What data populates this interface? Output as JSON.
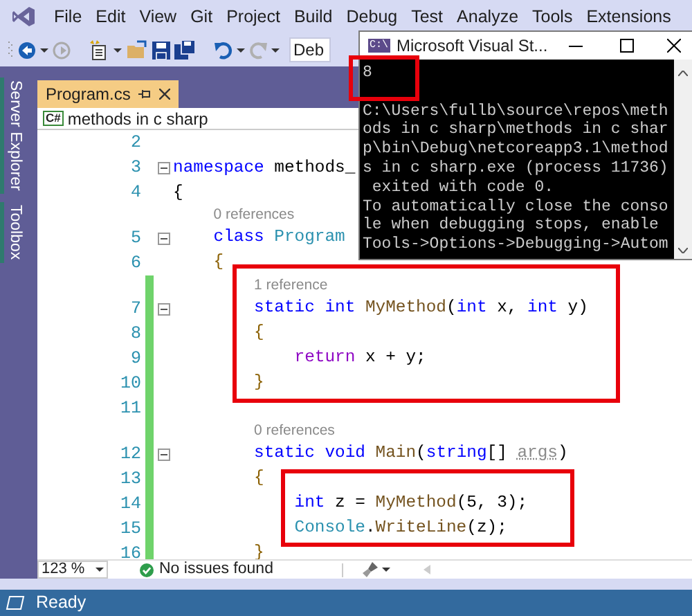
{
  "menu": {
    "items": [
      "File",
      "Edit",
      "View",
      "Git",
      "Project",
      "Build",
      "Debug",
      "Test",
      "Analyze",
      "Tools",
      "Extensions"
    ]
  },
  "toolbar": {
    "configuration": "Deb"
  },
  "side_tabs": [
    "Server Explorer",
    "Toolbox"
  ],
  "document_tabs": [
    {
      "title": "Program.cs",
      "selected": true
    }
  ],
  "navigation_bar": {
    "file_icon": "C#",
    "project": "methods in c sharp"
  },
  "editor": {
    "lines": [
      {
        "kind": "code",
        "number": "2",
        "changed": false,
        "foldable": false
      },
      {
        "kind": "code",
        "number": "3",
        "changed": false,
        "foldable": true,
        "tokens": [
          {
            "kind": "keyword",
            "text": "namespace "
          },
          {
            "kind": "plain",
            "text": "methods_"
          }
        ]
      },
      {
        "kind": "code",
        "number": "4",
        "changed": false,
        "foldable": false,
        "tokens": [
          {
            "kind": "plain",
            "text": "{"
          }
        ]
      },
      {
        "kind": "codelens",
        "text": "0 references",
        "changed": false
      },
      {
        "kind": "code",
        "number": "5",
        "changed": false,
        "foldable": true,
        "tokens": [
          {
            "kind": "keyword",
            "text": "    class "
          },
          {
            "kind": "type",
            "text": "Program"
          }
        ]
      },
      {
        "kind": "code",
        "number": "6",
        "changed": false,
        "foldable": false,
        "tokens": [
          {
            "kind": "brace",
            "text": "    {"
          }
        ]
      },
      {
        "kind": "codelens",
        "text": "1 reference",
        "changed": true
      },
      {
        "kind": "code",
        "number": "7",
        "changed": true,
        "foldable": true,
        "tokens": [
          {
            "kind": "keyword",
            "text": "        static int "
          },
          {
            "kind": "method",
            "text": "MyMethod"
          },
          {
            "kind": "plain",
            "text": "("
          },
          {
            "kind": "keyword",
            "text": "int "
          },
          {
            "kind": "plain",
            "text": "x, "
          },
          {
            "kind": "keyword",
            "text": "int "
          },
          {
            "kind": "plain",
            "text": "y)"
          }
        ]
      },
      {
        "kind": "code",
        "number": "8",
        "changed": true,
        "foldable": false,
        "tokens": [
          {
            "kind": "brace",
            "text": "        {"
          }
        ]
      },
      {
        "kind": "code",
        "number": "9",
        "changed": true,
        "foldable": false,
        "tokens": [
          {
            "kind": "control",
            "text": "            return "
          },
          {
            "kind": "plain",
            "text": "x + y;"
          }
        ]
      },
      {
        "kind": "code",
        "number": "10",
        "changed": true,
        "foldable": false,
        "tokens": [
          {
            "kind": "brace",
            "text": "        }"
          }
        ]
      },
      {
        "kind": "code",
        "number": "11",
        "changed": true,
        "foldable": false
      },
      {
        "kind": "codelens",
        "text": "0 references",
        "changed": true
      },
      {
        "kind": "code",
        "number": "12",
        "changed": true,
        "foldable": true,
        "tokens": [
          {
            "kind": "keyword",
            "text": "        static void "
          },
          {
            "kind": "method",
            "text": "Main"
          },
          {
            "kind": "plain",
            "text": "("
          },
          {
            "kind": "keyword",
            "text": "string"
          },
          {
            "kind": "plain",
            "text": "[] "
          },
          {
            "kind": "unused",
            "text": "args"
          },
          {
            "kind": "plain",
            "text": ")"
          }
        ]
      },
      {
        "kind": "code",
        "number": "13",
        "changed": true,
        "foldable": false,
        "tokens": [
          {
            "kind": "brace",
            "text": "        {"
          }
        ]
      },
      {
        "kind": "code",
        "number": "14",
        "changed": true,
        "foldable": false,
        "tokens": [
          {
            "kind": "keyword",
            "text": "            int "
          },
          {
            "kind": "plain",
            "text": "z = "
          },
          {
            "kind": "method",
            "text": "MyMethod"
          },
          {
            "kind": "plain",
            "text": "(5, 3);"
          }
        ]
      },
      {
        "kind": "code",
        "number": "15",
        "changed": true,
        "foldable": false,
        "tokens": [
          {
            "kind": "type",
            "text": "            Console"
          },
          {
            "kind": "plain",
            "text": "."
          },
          {
            "kind": "method",
            "text": "WriteLine"
          },
          {
            "kind": "plain",
            "text": "(z);"
          }
        ]
      },
      {
        "kind": "code",
        "number": "16",
        "changed": true,
        "foldable": false,
        "tokens": [
          {
            "kind": "brace",
            "text": "        }"
          }
        ]
      }
    ]
  },
  "editor_footer": {
    "zoom": "123 %",
    "issues": "No issues found"
  },
  "console_window": {
    "icon": "C:\\",
    "title": "Microsoft Visual St...",
    "output": "8",
    "messages": [
      "C:\\Users\\fullb\\source\\repos\\meth",
      "ods in c sharp\\methods in c shar",
      "p\\bin\\Debug\\netcoreapp3.1\\method",
      "s in c sharp.exe (process 11736)",
      " exited with code 0.",
      "To automatically close the conso",
      "le when debugging stops, enable",
      "Tools->Options->Debugging->Autom"
    ]
  },
  "status_bar": {
    "text": "Ready"
  }
}
